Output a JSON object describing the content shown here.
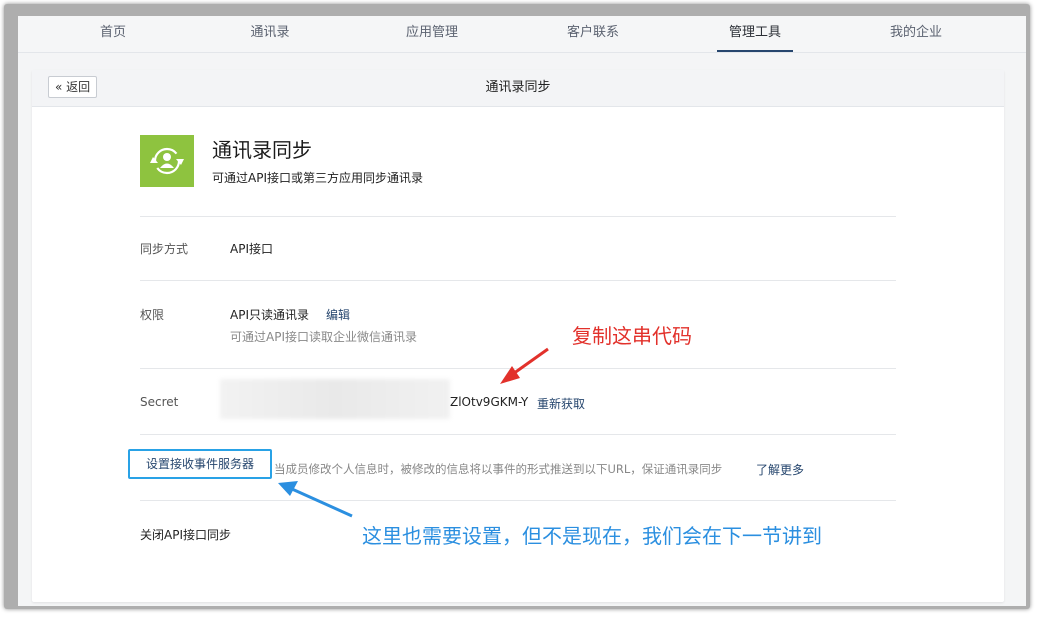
{
  "nav": {
    "items": [
      {
        "label": "首页"
      },
      {
        "label": "通讯录"
      },
      {
        "label": "应用管理"
      },
      {
        "label": "客户联系"
      },
      {
        "label": "管理工具"
      },
      {
        "label": "我的企业"
      }
    ],
    "active_index": 4
  },
  "card": {
    "back_label": "« 返回",
    "title": "通讯录同步"
  },
  "app": {
    "icon": "contacts-sync-icon",
    "icon_color": "#8ec33f",
    "title": "通讯录同步",
    "subtitle": "可通过API接口或第三方应用同步通讯录"
  },
  "rows": {
    "sync_method": {
      "label": "同步方式",
      "value": "API接口"
    },
    "permission": {
      "label": "权限",
      "value": "API只读通讯录",
      "edit_link": "编辑",
      "hint": "可通过API接口读取企业微信通讯录"
    },
    "secret": {
      "label": "Secret",
      "value": "ZlOtv9GKM-Y",
      "refresh_link": "重新获取"
    },
    "event_server": {
      "button_label": "设置接收事件服务器",
      "hint": "当成员修改个人信息时，被修改的信息将以事件的形式推送到以下URL，保证通讯录同步",
      "learn_more": "了解更多"
    },
    "close_api": {
      "label": "关闭API接口同步"
    }
  },
  "annotations": {
    "copy_note": "复制这串代码",
    "setup_note": "这里也需要设置，但不是现在，我们会在下一节讲到",
    "red_color": "#e2312b",
    "blue_color": "#2b8fe0"
  }
}
